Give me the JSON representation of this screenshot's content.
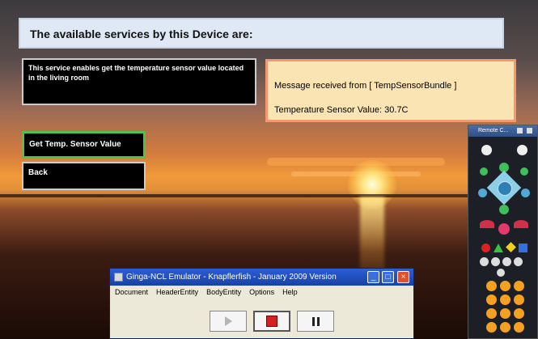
{
  "app": {
    "services_header": "The available services by this Device are:",
    "service_description": "This service enables get the temperature sensor value located in the living room",
    "message": {
      "received_line": "Message received from [ TempSensorBundle ]",
      "temperature_line": "Temperature Sensor Value: 30.7C"
    },
    "buttons": {
      "get_temp": "Get Temp. Sensor Value",
      "back": "Back"
    }
  },
  "remote": {
    "title": "Remote C..."
  },
  "emulator": {
    "title": "Ginga-NCL Emulator - Knapflerfish - January 2009 Version",
    "menu": [
      "Document",
      "HeaderEntity",
      "BodyEntity",
      "Options",
      "Help"
    ],
    "controls": [
      "play",
      "stop",
      "pause"
    ]
  },
  "colors": {
    "header_bg": "#dfe8f5",
    "message_bg": "#fbe4b4",
    "message_border": "#f29a6e",
    "focus_border": "#4ec34a",
    "titlebar": "#2a5fd6"
  }
}
